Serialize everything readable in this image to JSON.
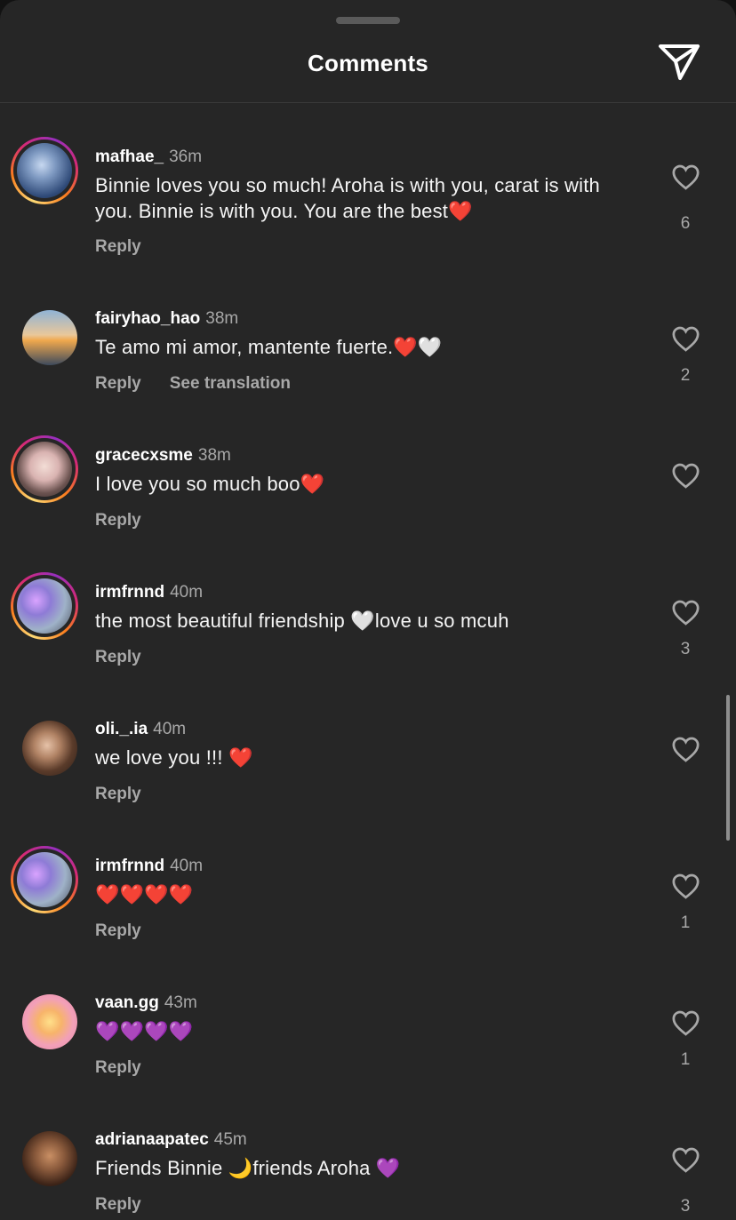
{
  "header": {
    "title": "Comments",
    "share_icon": "paper-plane-icon"
  },
  "colors": {
    "background": "#262626",
    "muted_text": "#a8a8a8",
    "story_ring": [
      "#feda75",
      "#fa7e1e",
      "#d62976",
      "#962fbf"
    ]
  },
  "comments": [
    {
      "username": "mafhae_",
      "time": "36m",
      "text": "Binnie loves you so much! Aroha is with you, carat is with you. Binnie is with you. You are the best❤️",
      "reply": "Reply",
      "likes": "6"
    },
    {
      "username": "fairyhao_hao",
      "time": "38m",
      "text": "Te amo mi amor, mantente fuerte.❤️🤍",
      "reply": "Reply",
      "see_translation": "See translation",
      "likes": "2"
    },
    {
      "username": "gracecxsme",
      "time": "38m",
      "text": "I love you so much boo❤️",
      "reply": "Reply",
      "likes": ""
    },
    {
      "username": "irmfrnnd",
      "time": "40m",
      "text": "the most beautiful friendship 🤍love u so mcuh",
      "reply": "Reply",
      "likes": "3"
    },
    {
      "username": "oli._.ia",
      "time": "40m",
      "text": "we love you !!! ❤️",
      "reply": "Reply",
      "likes": ""
    },
    {
      "username": "irmfrnnd",
      "time": "40m",
      "text": "❤️❤️❤️❤️",
      "reply": "Reply",
      "likes": "1"
    },
    {
      "username": "vaan.gg",
      "time": "43m",
      "text": "💜💜💜💜",
      "reply": "Reply",
      "likes": "1"
    },
    {
      "username": "adrianaapatec",
      "time": "45m",
      "text": "Friends Binnie 🌙friends Aroha 💜",
      "reply": "Reply",
      "likes": "3"
    }
  ]
}
